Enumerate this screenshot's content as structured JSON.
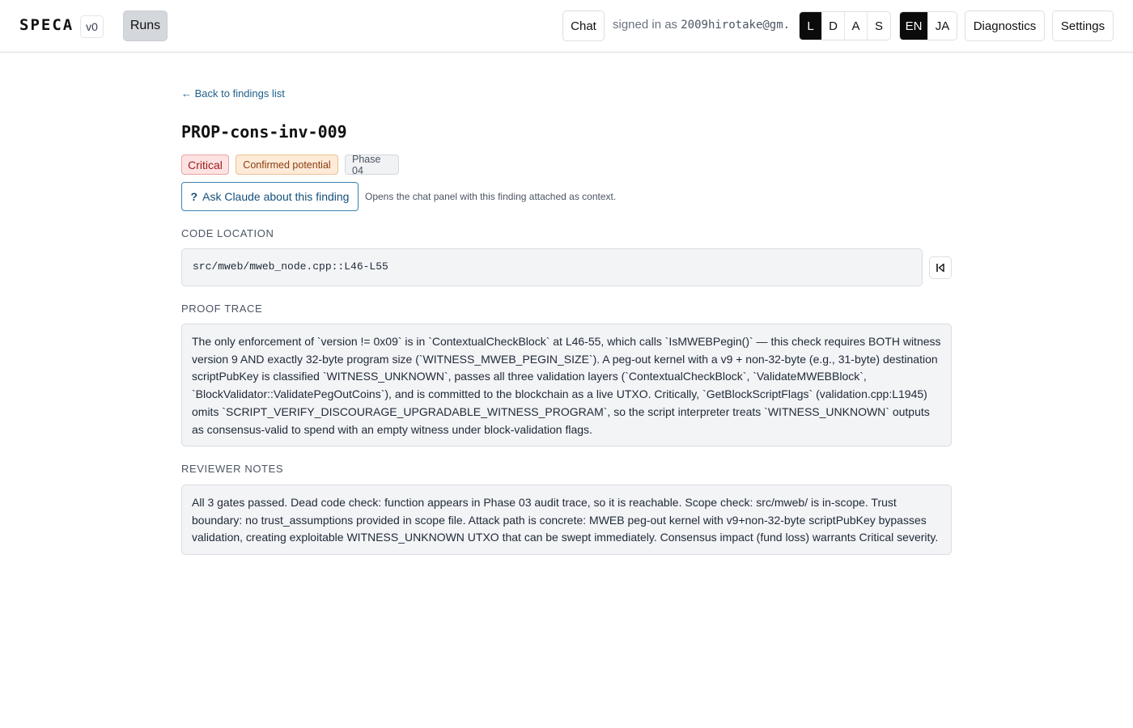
{
  "header": {
    "brand": "SPECA",
    "version": "v0",
    "runs_label": "Runs",
    "chat_label": "Chat",
    "signed_in_prefix": "signed in as",
    "user_email": "2009hirotake@gm...",
    "theme_options": [
      "L",
      "D",
      "A",
      "S"
    ],
    "theme_active": "L",
    "lang_options": [
      "EN",
      "JA"
    ],
    "lang_active": "EN",
    "diagnostics_label": "Diagnostics",
    "settings_label": "Settings"
  },
  "main": {
    "back_link": "← Back to findings list",
    "title": "PROP-cons-inv-009",
    "badges": {
      "severity": "Critical",
      "status": "Confirmed potential",
      "phase": "Phase 04"
    },
    "ask_button": {
      "icon": "?",
      "label": "Ask Claude about this finding"
    },
    "ask_hint": "Opens the chat panel with this finding attached as context.",
    "code_location": {
      "label": "CODE LOCATION",
      "value": "src/mweb/mweb_node.cpp::L46-L55",
      "copy_icon": "copy-icon"
    },
    "proof_trace": {
      "label": "PROOF TRACE",
      "text": "The only enforcement of `version != 0x09` is in `ContextualCheckBlock` at L46-55, which calls `IsMWEBPegin()` — this check requires BOTH witness version 9 AND exactly 32-byte program size (`WITNESS_MWEB_PEGIN_SIZE`). A peg-out kernel with a v9 + non-32-byte (e.g., 31-byte) destination scriptPubKey is classified `WITNESS_UNKNOWN`, passes all three validation layers (`ContextualCheckBlock`, `ValidateMWEBBlock`, `BlockValidator::ValidatePegOutCoins`), and is committed to the blockchain as a live UTXO. Critically, `GetBlockScriptFlags` (validation.cpp:L1945) omits `SCRIPT_VERIFY_DISCOURAGE_UPGRADABLE_WITNESS_PROGRAM`, so the script interpreter treats `WITNESS_UNKNOWN` outputs as consensus-valid to spend with an empty witness under block-validation flags."
    },
    "reviewer_notes": {
      "label": "REVIEWER NOTES",
      "text": "All 3 gates passed. Dead code check: function appears in Phase 03 audit trace, so it is reachable. Scope check: src/mweb/ is in-scope. Trust boundary: no trust_assumptions provided in scope file. Attack path is concrete: MWEB peg-out kernel with v9+non-32-byte scriptPubKey bypasses validation, creating exploitable WITNESS_UNKNOWN UTXO that can be swept immediately. Consensus impact (fund loss) warrants Critical severity."
    }
  },
  "colors": {
    "accent_link": "#1f5f8b",
    "critical_bg": "#fde2e2",
    "status_bg": "#fdebd8",
    "active_toggle": "#0b0b0b"
  }
}
